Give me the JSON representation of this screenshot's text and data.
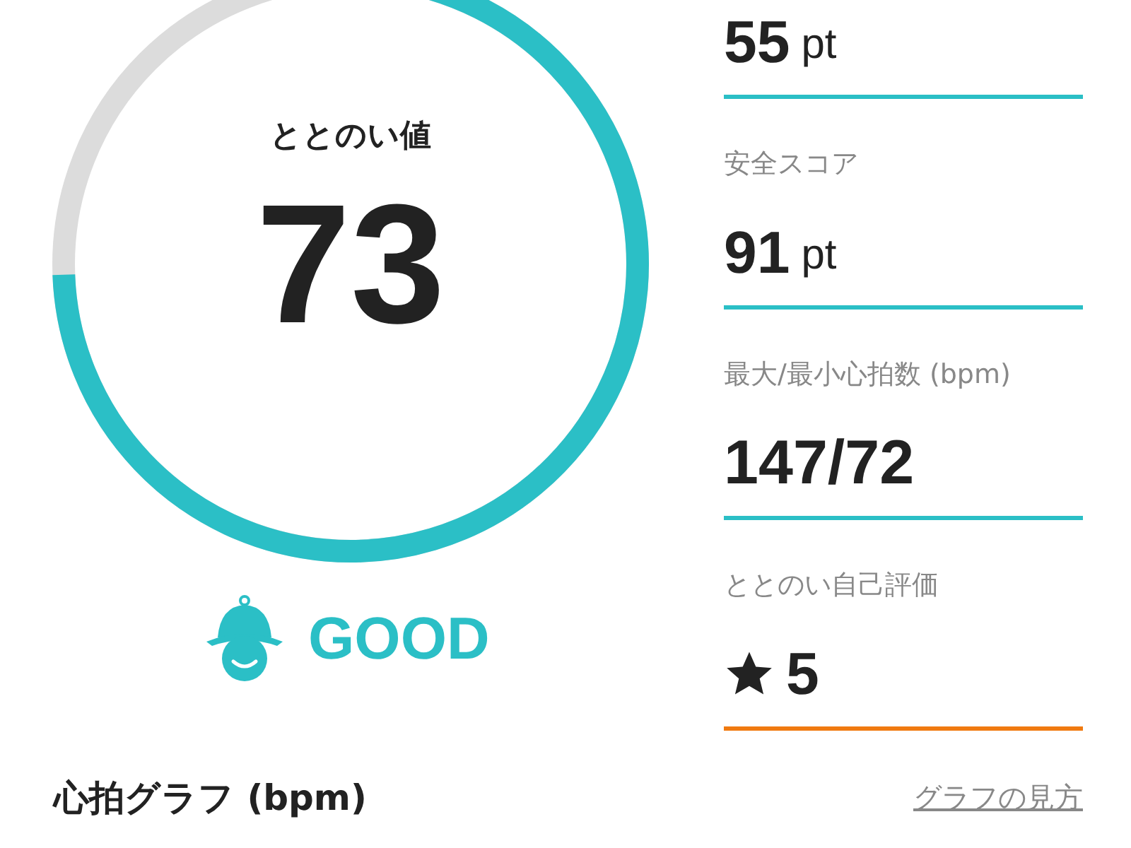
{
  "gauge": {
    "title": "ととのい値",
    "value": "73",
    "level": 0.73,
    "status": "GOOD"
  },
  "metrics": [
    {
      "kind": "score",
      "value": "55",
      "unit": "pt",
      "color": "#2bbfc6"
    },
    {
      "kind": "score",
      "label": "安全スコア",
      "value": "91",
      "unit": "pt",
      "color": "#2bbfc6"
    },
    {
      "kind": "plain",
      "label": "最大/最小心拍数 (bpm)",
      "value": "147/72",
      "color": "#2bbfc6"
    },
    {
      "kind": "rating",
      "label": "ととのい自己評価",
      "value": "5",
      "color": "#f07a10"
    }
  ],
  "graph_section": {
    "title": "心拍グラフ (bpm)",
    "help_link": "グラフの見方"
  }
}
